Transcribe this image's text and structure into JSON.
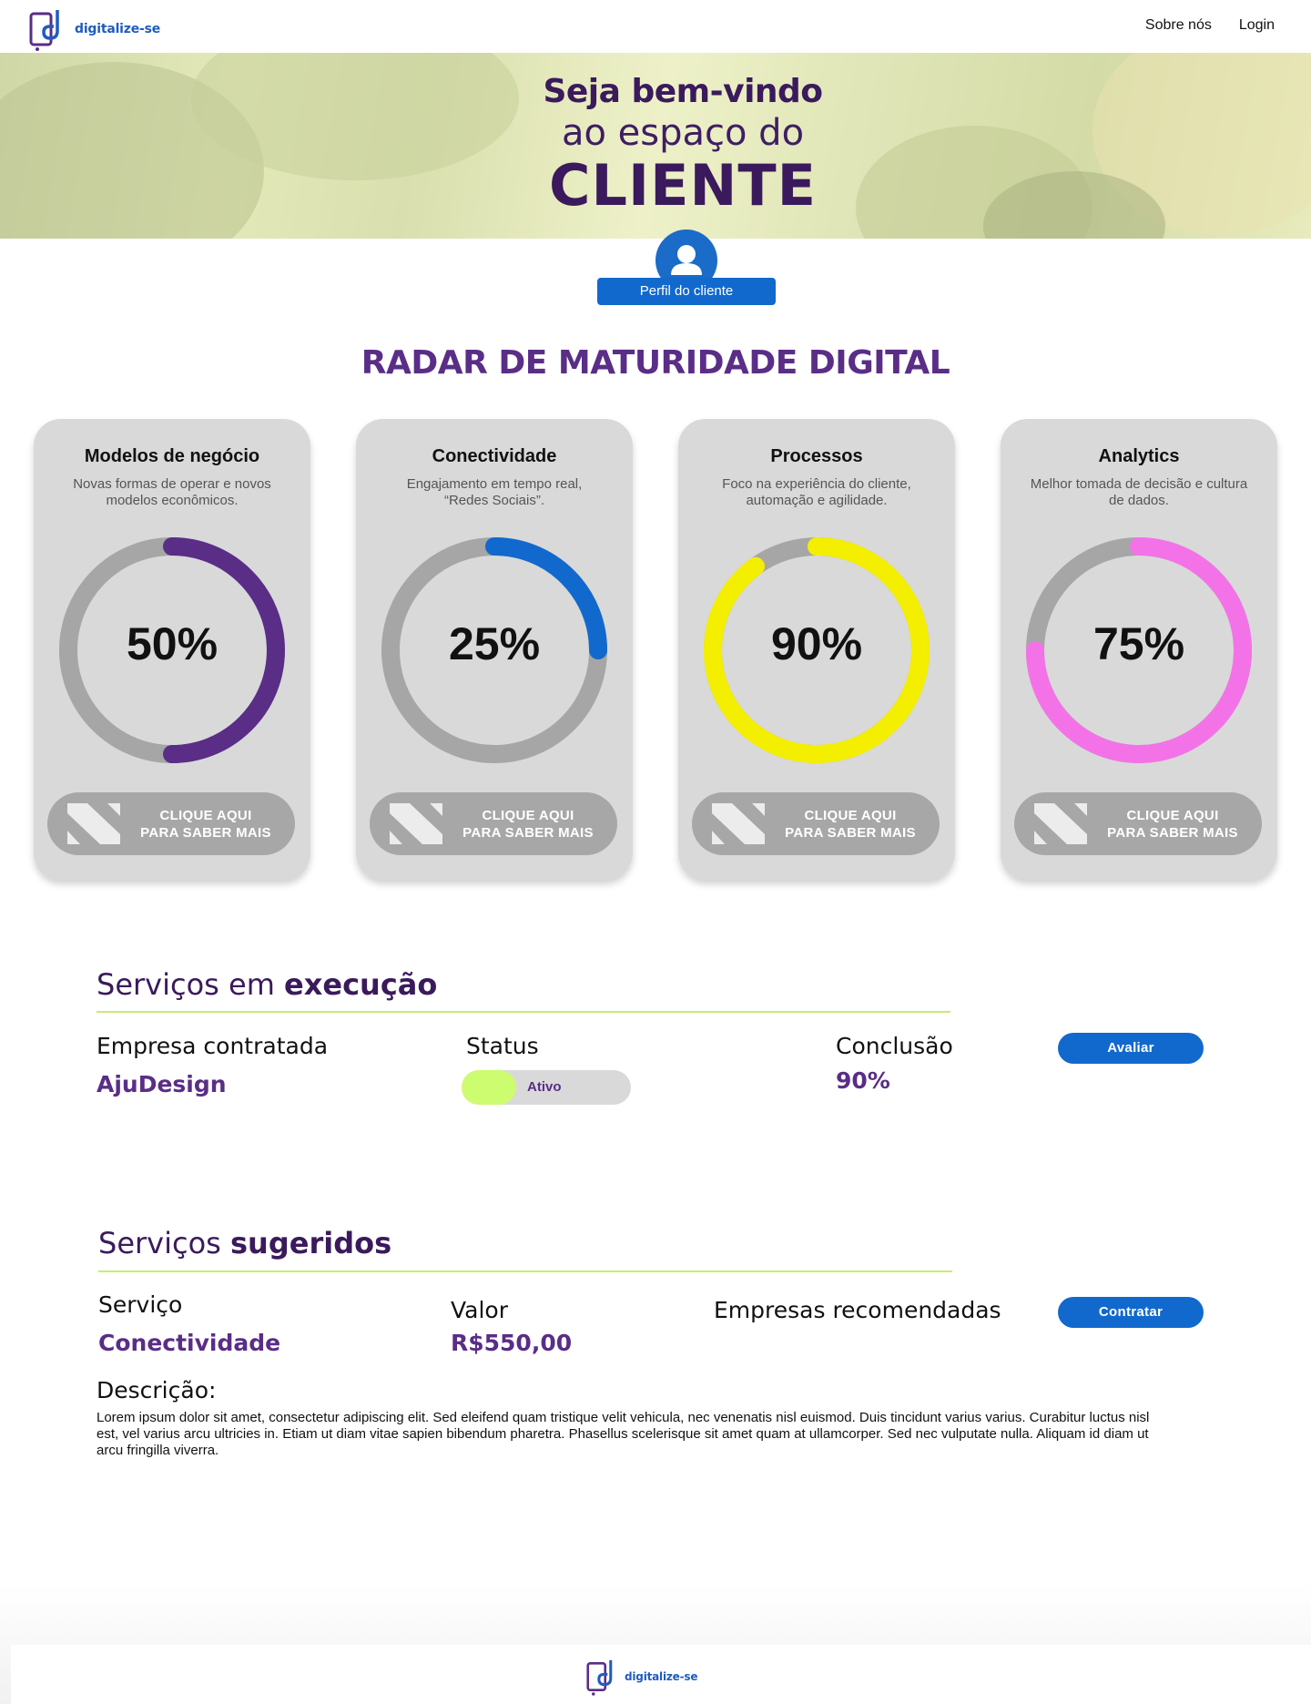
{
  "brand": {
    "name": "digitalize-se",
    "logo_color": "#1f5cc0",
    "accent_purple": "#5a2d87"
  },
  "nav": {
    "about": "Sobre nós",
    "login": "Login"
  },
  "hero": {
    "line1": "Seja bem-vindo",
    "line2": "ao espaço do",
    "line3": "CLIENTE"
  },
  "profile": {
    "button_label": "Perfil do cliente",
    "icon": "user-icon"
  },
  "radar": {
    "title": "RADAR DE MATURIDADE DIGITAL",
    "cards": [
      {
        "title": "Modelos de negócio",
        "description": "Novas formas de operar e novos modelos econômicos.",
        "value_label": "50%",
        "value": 50,
        "color": "#5a2d87",
        "button_line1": "CLIQUE AQUI",
        "button_line2": "PARA SABER MAIS"
      },
      {
        "title": "Conectividade",
        "description": "Engajamento em tempo real, “Redes Sociais”.",
        "value_label": "25%",
        "value": 25,
        "color": "#1169cd",
        "button_line1": "CLIQUE AQUI",
        "button_line2": "PARA SABER MAIS"
      },
      {
        "title": "Processos",
        "description": "Foco na experiência do cliente, automação e agilidade.",
        "value_label": "90%",
        "value": 90,
        "color": "#f4ef00",
        "button_line1": "CLIQUE AQUI",
        "button_line2": "PARA SABER MAIS"
      },
      {
        "title": "Analytics",
        "description": "Melhor tomada de decisão e cultura de dados.",
        "value_label": "75%",
        "value": 75,
        "color": "#f472e8",
        "button_line1": "CLIQUE AQUI",
        "button_line2": "PARA SABER MAIS"
      }
    ]
  },
  "running": {
    "title_normal": "Serviços em ",
    "title_bold": "execução",
    "company_label": "Empresa contratada",
    "company_value": "AjuDesign",
    "status_label": "Status",
    "status_value": "Ativo",
    "conclusion_label": "Conclusão",
    "conclusion_value": "90%",
    "action": "Avaliar"
  },
  "suggested": {
    "title_normal": "Serviços ",
    "title_bold": "sugeridos",
    "service_label": "Serviço",
    "service_value": "Conectividade",
    "price_label": "Valor",
    "price_value": "R$550,00",
    "companies_label": "Empresas recomendadas",
    "action": "Contratar",
    "description_label": "Descrição:",
    "description_text": "Lorem ipsum dolor sit amet, consectetur adipiscing elit. Sed eleifend quam tristique velit vehicula, nec venenatis nisl euismod. Duis tincidunt varius varius. Curabitur luctus nisl est, vel varius arcu ultricies in. Etiam ut diam vitae sapien bibendum pharetra. Phasellus scelerisque sit amet quam at ullamcorper. Sed nec vulputate nulla. Aliquam id diam ut arcu fringilla viverra."
  },
  "footer": {
    "brand": "digitalize-se"
  }
}
